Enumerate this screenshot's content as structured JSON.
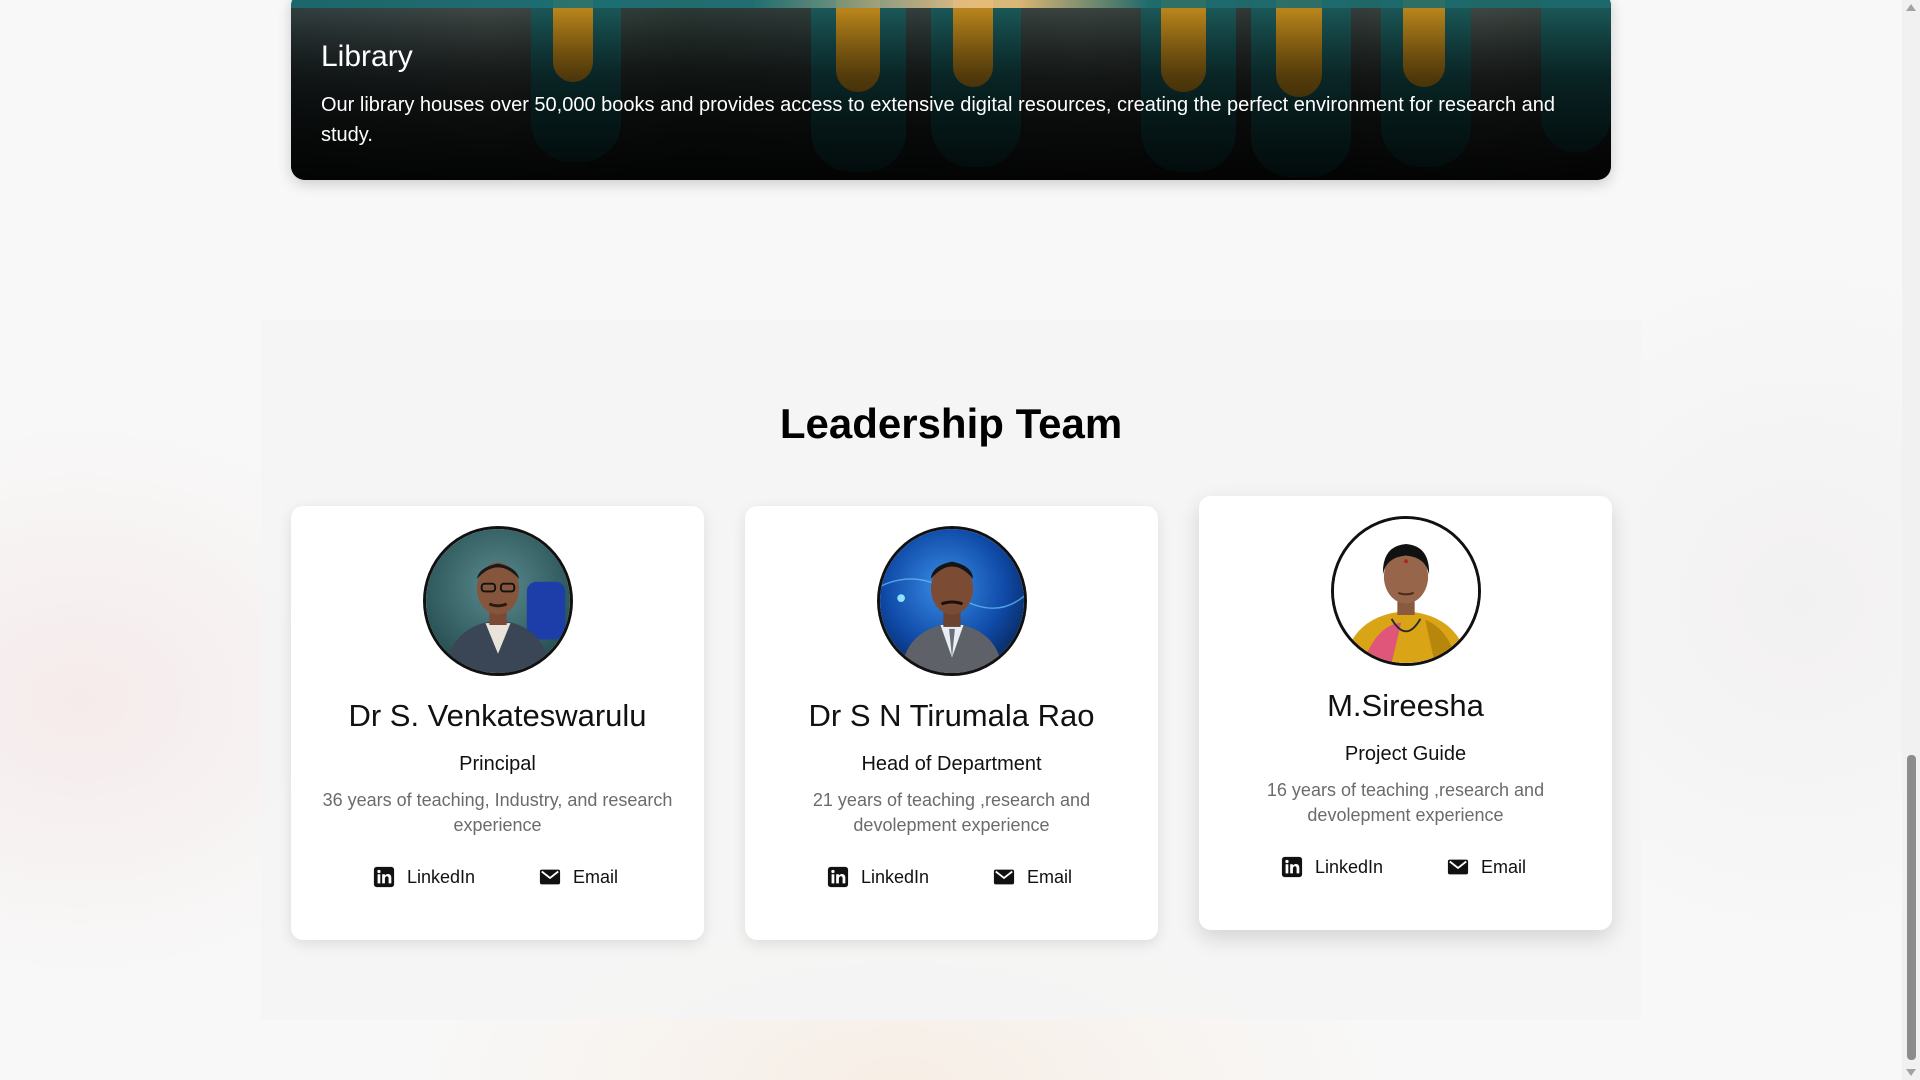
{
  "library": {
    "title": "Library",
    "description": "Our library houses over 50,000 books and provides access to extensive digital resources, creating the perfect environment for research and study."
  },
  "leadership": {
    "title": "Leadership Team",
    "members": [
      {
        "name": "Dr S. Venkateswarulu",
        "role": "Principal",
        "experience": "36 years of teaching, Industry, and research experience",
        "linkedin_label": "LinkedIn",
        "email_label": "Email"
      },
      {
        "name": "Dr S N Tirumala Rao",
        "role": "Head of Department",
        "experience": "21 years of teaching ,research and devolepment experience",
        "linkedin_label": "LinkedIn",
        "email_label": "Email"
      },
      {
        "name": "M.Sireesha",
        "role": "Project Guide",
        "experience": "16 years of teaching ,research and devolepment experience",
        "linkedin_label": "LinkedIn",
        "email_label": "Email"
      }
    ]
  },
  "icons": {
    "linkedin": "linkedin-icon",
    "email": "email-icon"
  },
  "colors": {
    "card_background": "#ffffff",
    "section_background": "#f4f4f4",
    "muted_text": "#6b6b6b"
  }
}
